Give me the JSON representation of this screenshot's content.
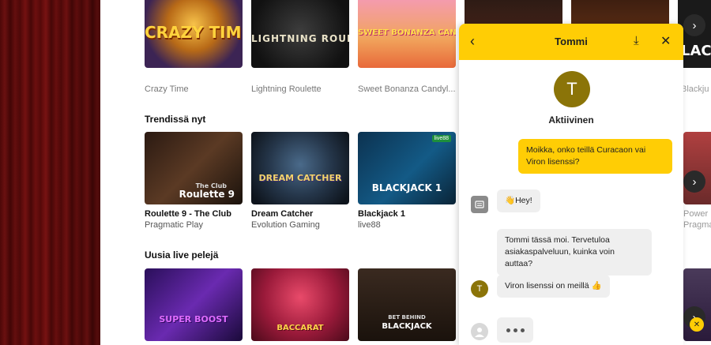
{
  "rows": {
    "top": {
      "games": [
        {
          "title": "Crazy Time",
          "art": "CRAZY TIME"
        },
        {
          "title": "Lightning Roulette",
          "art": "LIGHTNING ROULETTE"
        },
        {
          "title": "Sweet Bonanza Candyl...",
          "art": "SWEET BONANZA CANDYLAND"
        },
        {
          "title": "",
          "art": ""
        },
        {
          "title": "",
          "art": ""
        },
        {
          "title": "Blackju",
          "art": "LAC"
        }
      ]
    },
    "trending": {
      "title": "Trendissä nyt",
      "games": [
        {
          "name": "Roulette 9 - The Club",
          "provider": "Pragmatic Play",
          "art": "Roulette 9",
          "art_sub": "The Club"
        },
        {
          "name": "Dream Catcher",
          "provider": "Evolution Gaming",
          "art": "DREAM CATCHER"
        },
        {
          "name": "Blackjack 1",
          "provider": "live88",
          "art": "BLACKJACK 1",
          "badge": "live88"
        },
        {
          "name": "Power U",
          "provider": "Pragmat"
        }
      ]
    },
    "new_live": {
      "title": "Uusia live pelejä",
      "games": [
        {
          "art": "SUPER BOOST"
        },
        {
          "art": "BACCARAT"
        },
        {
          "art": "BLACKJACK",
          "art_sub": "BET BEHIND"
        }
      ]
    }
  },
  "chat": {
    "header": {
      "name": "Tommi",
      "back_icon": "chevron-left-icon",
      "download_icon": "download-icon",
      "close_icon": "close-icon"
    },
    "agent": {
      "initial": "T",
      "status": "Aktiivinen",
      "avatar_color": "#8b7408"
    },
    "messages": [
      {
        "from": "user",
        "text": "Moikka, onko teillä Curacaon vai Viron lisenssi?"
      },
      {
        "from": "bot",
        "text": "👋Hey!"
      },
      {
        "from": "agent",
        "text": "Tommi tässä moi. Tervetuloa asiakaspalveluun, kuinka voin auttaa?"
      },
      {
        "from": "agent",
        "text": "Viron lisenssi on meillä 👍"
      }
    ],
    "typing": true,
    "accent": "#ffcd05"
  },
  "nav": {
    "next_icon": "chevron-right-icon"
  }
}
